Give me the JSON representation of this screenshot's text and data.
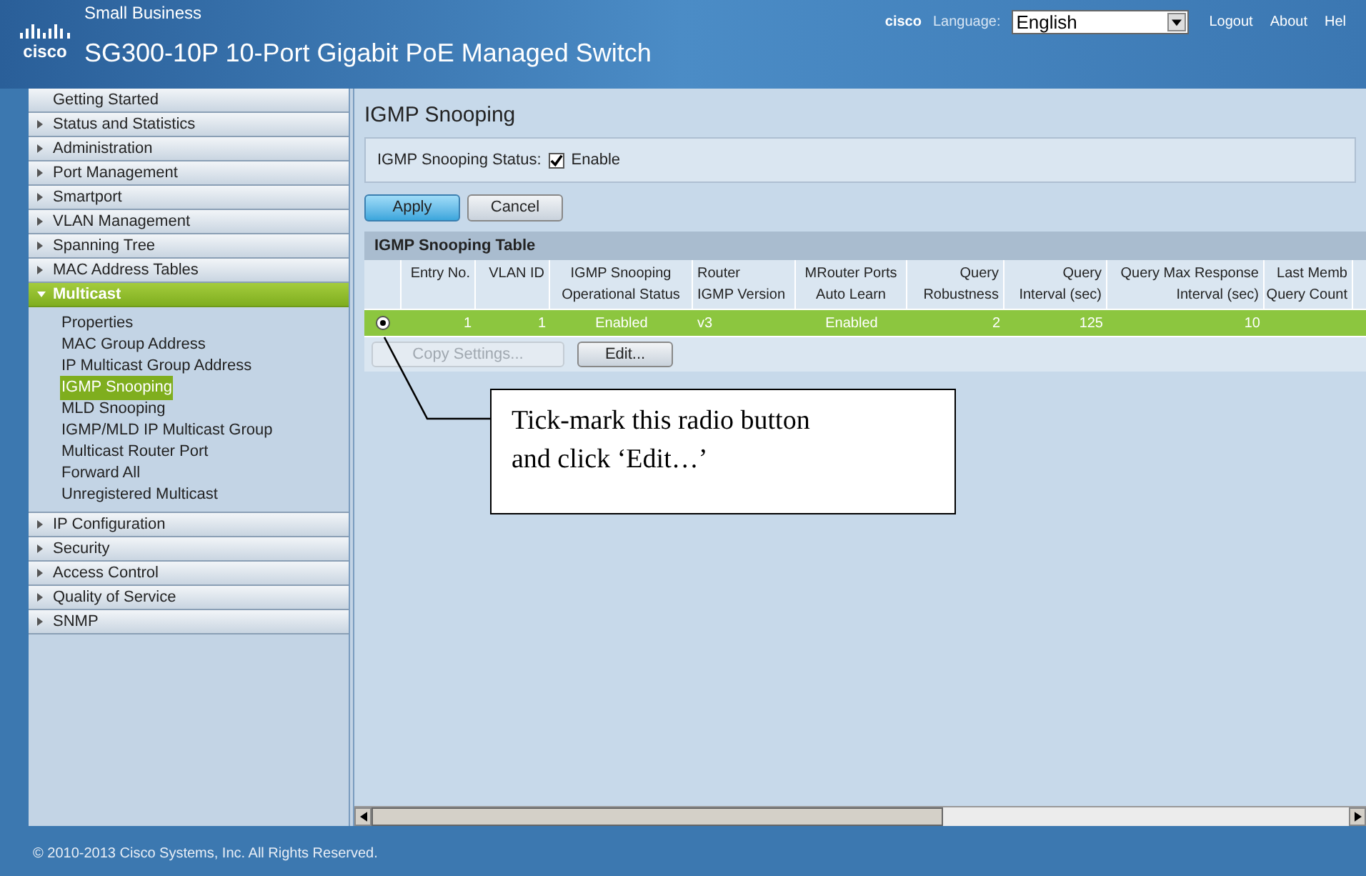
{
  "header": {
    "logo_text": "cisco",
    "brand_small": "Small Business",
    "title": "SG300-10P 10-Port Gigabit PoE Managed Switch",
    "cisco_link": "cisco",
    "language_label": "Language:",
    "language_value": "English",
    "links": [
      "Logout",
      "About",
      "Hel"
    ]
  },
  "sidebar": {
    "items": [
      {
        "label": "Getting Started",
        "expandable": false
      },
      {
        "label": "Status and Statistics",
        "expandable": true,
        "expanded": false
      },
      {
        "label": "Administration",
        "expandable": true,
        "expanded": false
      },
      {
        "label": "Port Management",
        "expandable": true,
        "expanded": false
      },
      {
        "label": "Smartport",
        "expandable": true,
        "expanded": false
      },
      {
        "label": "VLAN Management",
        "expandable": true,
        "expanded": false
      },
      {
        "label": "Spanning Tree",
        "expandable": true,
        "expanded": false
      },
      {
        "label": "MAC Address Tables",
        "expandable": true,
        "expanded": false
      },
      {
        "label": "Multicast",
        "expandable": true,
        "expanded": true,
        "children": [
          {
            "label": "Properties",
            "selected": false
          },
          {
            "label": "MAC Group Address",
            "selected": false
          },
          {
            "label": "IP Multicast Group Address",
            "selected": false
          },
          {
            "label": "IGMP Snooping",
            "selected": true
          },
          {
            "label": "MLD Snooping",
            "selected": false
          },
          {
            "label": "IGMP/MLD IP Multicast Group",
            "selected": false
          },
          {
            "label": "Multicast Router Port",
            "selected": false
          },
          {
            "label": "Forward All",
            "selected": false
          },
          {
            "label": "Unregistered Multicast",
            "selected": false
          }
        ]
      },
      {
        "label": "IP Configuration",
        "expandable": true,
        "expanded": false
      },
      {
        "label": "Security",
        "expandable": true,
        "expanded": false
      },
      {
        "label": "Access Control",
        "expandable": true,
        "expanded": false
      },
      {
        "label": "Quality of Service",
        "expandable": true,
        "expanded": false
      },
      {
        "label": "SNMP",
        "expandable": true,
        "expanded": false
      }
    ]
  },
  "page": {
    "title": "IGMP Snooping",
    "status_label": "IGMP Snooping Status:",
    "status_checked": true,
    "status_text": "Enable",
    "buttons": [
      {
        "label": "Apply",
        "kind": "primary"
      },
      {
        "label": "Cancel",
        "kind": "normal"
      }
    ]
  },
  "table": {
    "title": "IGMP Snooping Table",
    "columns": [
      "Entry No.",
      "VLAN ID",
      "IGMP Snooping\nOperational Status",
      "Router\nIGMP Version",
      "MRouter Ports\nAuto Learn",
      "Query\nRobustness",
      "Query\nInterval (sec)",
      "Query Max Response\nInterval (sec)",
      "Last Memb\nQuery Count"
    ],
    "rows": [
      {
        "selected": true,
        "cells": [
          "1",
          "1",
          "Enabled",
          "v3",
          "Enabled",
          "2",
          "125",
          "10"
        ]
      }
    ],
    "buttons": [
      {
        "label": "Copy Settings...",
        "disabled": true
      },
      {
        "label": "Edit...",
        "disabled": false
      }
    ]
  },
  "callout": {
    "text": "Tick-mark this radio button and click ‘Edit…’"
  },
  "footer": {
    "text": "© 2010-2013 Cisco Systems, Inc. All Rights Reserved."
  }
}
